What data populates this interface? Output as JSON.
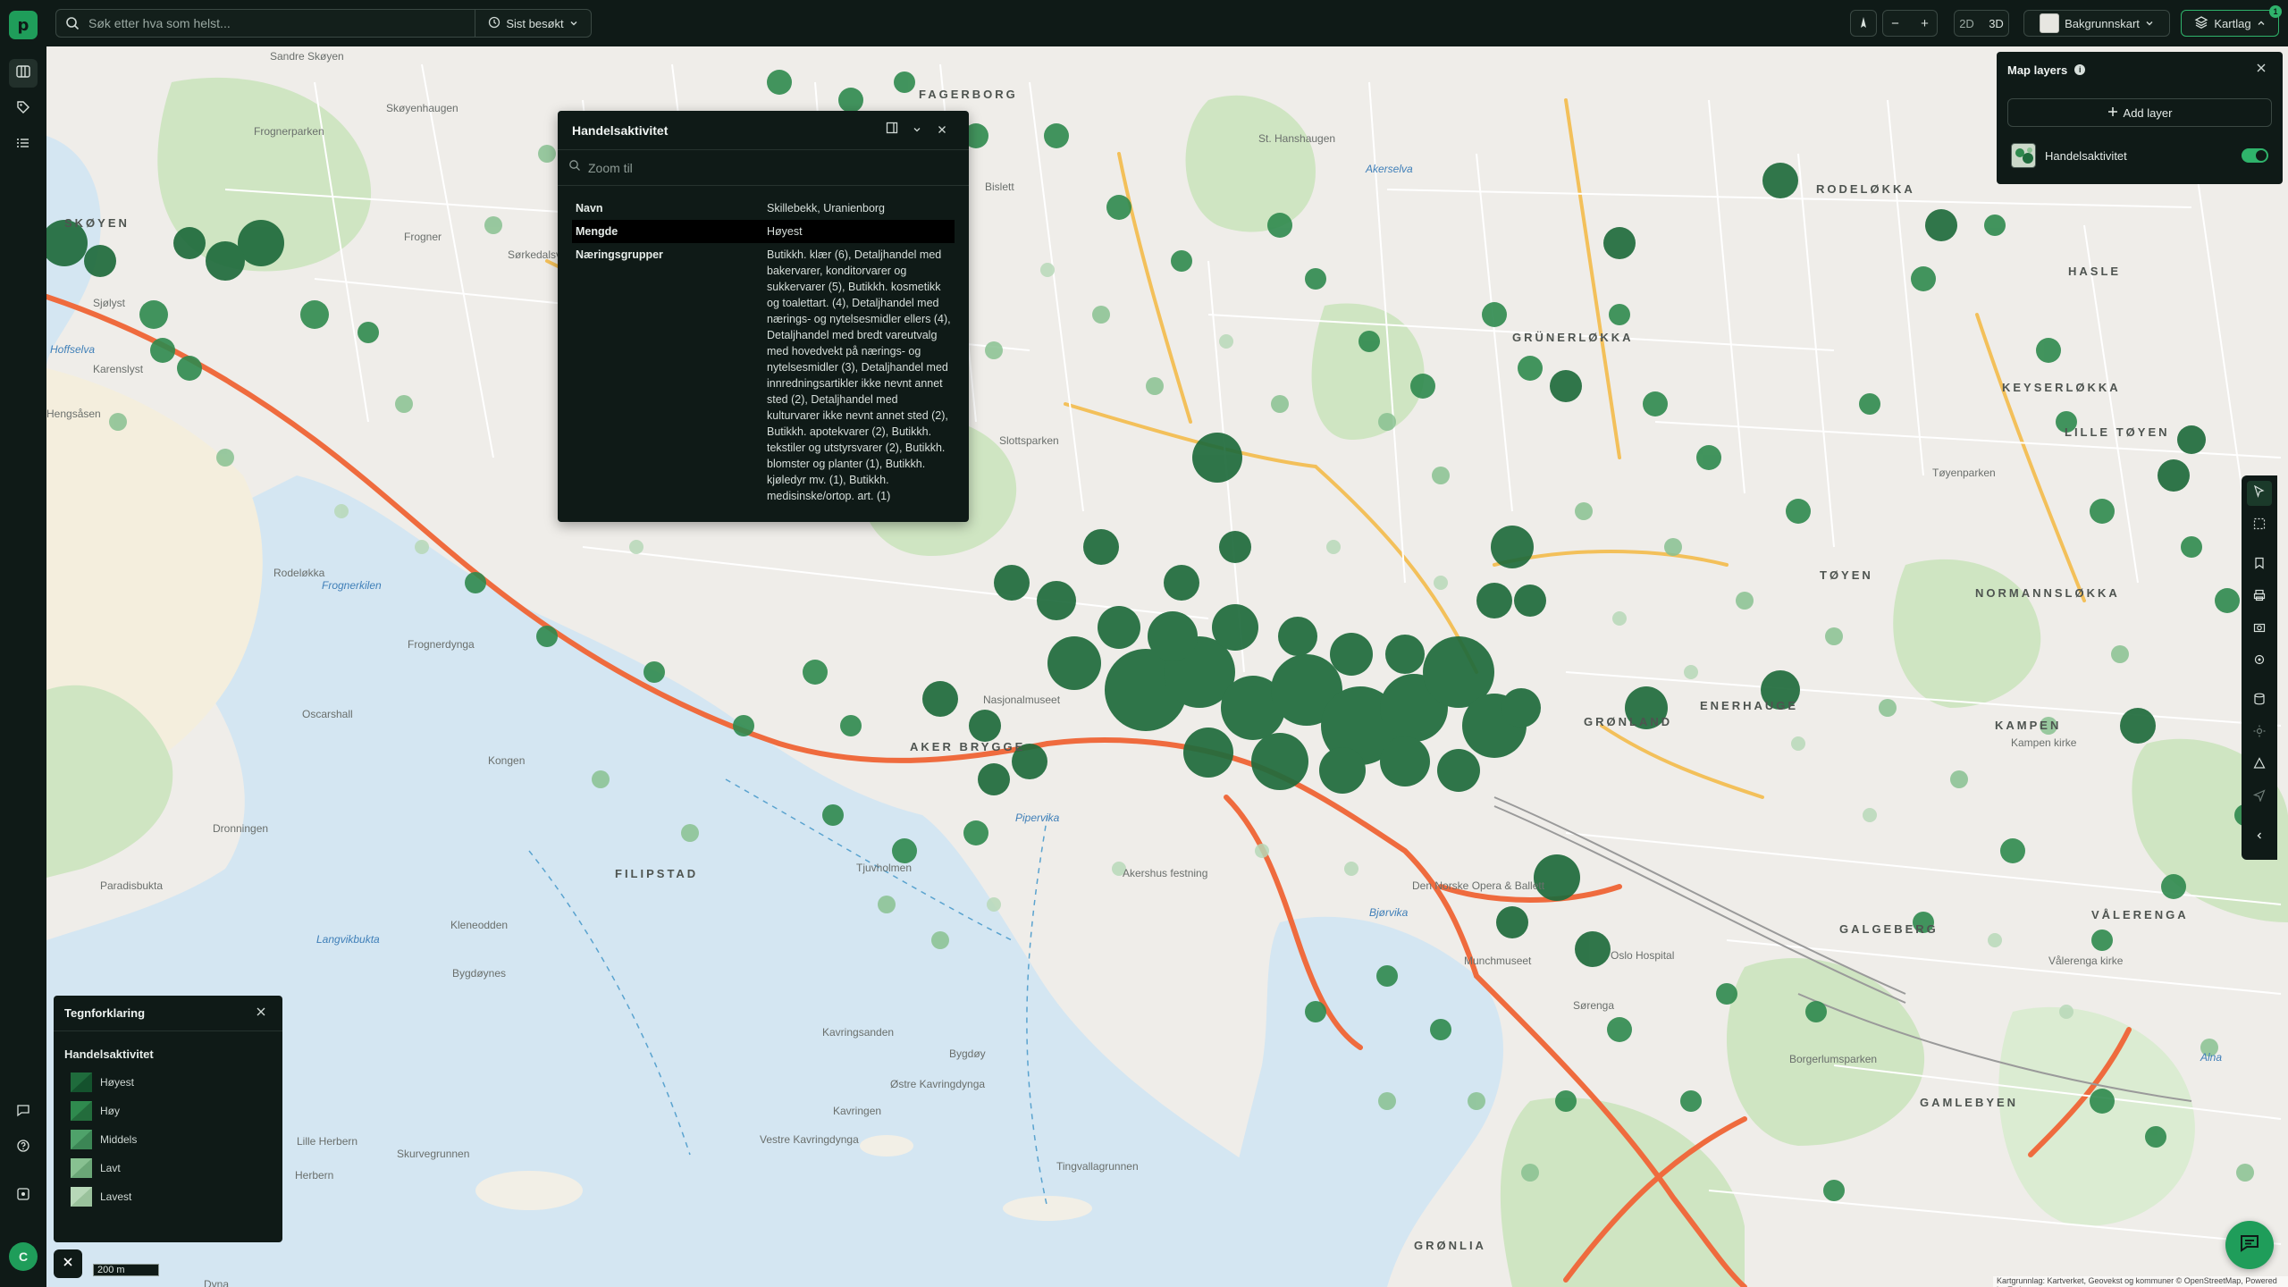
{
  "app": {
    "logo_letter": "p"
  },
  "search": {
    "placeholder": "Søk etter hva som helst...",
    "recent_label": "Sist besøkt"
  },
  "toolbar": {
    "zoom_out": "−",
    "zoom_in": "+",
    "mode_2d": "2D",
    "mode_3d": "3D",
    "basemap_label": "Bakgrunnskart",
    "layers_label": "Kartlag",
    "layers_badge": "1"
  },
  "user": {
    "initial": "C"
  },
  "popup": {
    "title": "Handelsaktivitet",
    "zoom_placeholder": "Zoom til",
    "rows": [
      {
        "key": "Navn",
        "value": "Skillebekk, Uranienborg"
      },
      {
        "key": "Mengde",
        "value": "Høyest"
      },
      {
        "key": "Næringsgrupper",
        "value": "Butikkh. klær (6), Detaljhandel med bakervarer, konditorvarer og sukkervarer (5), Butikkh. kosmetikk og toalettart. (4), Detaljhandel med nærings- og nytelsesmidler ellers (4), Detaljhandel med bredt vareutvalg med hovedvekt på nærings- og nytelsesmidler (3), Detaljhandel med innredningsartikler ikke nevnt annet sted (2), Detaljhandel med kulturvarer ikke nevnt annet sted (2), Butikkh. apotekvarer (2), Butikkh. tekstiler og utstyrsvarer (2), Butikkh. blomster og planter (1), Butikkh. kjøledyr mv. (1), Butikkh. medisinske/ortop. art. (1)"
      }
    ]
  },
  "layers_panel": {
    "title": "Map layers",
    "add_label": "Add layer",
    "items": [
      {
        "name": "Handelsaktivitet",
        "enabled": true
      }
    ]
  },
  "legend": {
    "title": "Tegnforklaring",
    "layer": "Handelsaktivitet",
    "items": [
      {
        "label": "Høyest",
        "color": "#1f6b3c"
      },
      {
        "label": "Høy",
        "color": "#2f8a4e"
      },
      {
        "label": "Middels",
        "color": "#4fa26a"
      },
      {
        "label": "Lavt",
        "color": "#88c191"
      },
      {
        "label": "Lavest",
        "color": "#b7d8b8"
      }
    ]
  },
  "scale": {
    "label": "200 m"
  },
  "attribution": "Kartgrunnlag: Kartverket, Geovekst og kommuner © OpenStreetMap, Powered by Esri",
  "map_labels": {
    "districts": [
      "SKØYEN",
      "FAGERBORG",
      "RODELØKKA",
      "HASLE",
      "GRÜNERLØKKA",
      "KEYSERLØKKA",
      "LILLE TØYEN",
      "TØYEN",
      "NORMANNSLØKKA",
      "ENERHAUGE",
      "KAMPEN",
      "GRØNLAND",
      "AKER BRYGGE",
      "FILIPSTAD",
      "VÅLERENGA",
      "GALGEBERG",
      "GAMLEBYEN",
      "GRØNLIA"
    ],
    "places": [
      "Sandre Skøyen",
      "Skøyenhaugen",
      "Frogner",
      "Frognerparken",
      "Hengsåsen",
      "Karenslyst",
      "Rodeløkka",
      "Bygdøy",
      "Sørkedalsveien",
      "St. Hanshaugen",
      "Akerselva",
      "Bislett",
      "Nasjonalmuseet",
      "Slottsparken",
      "Tjuvholmen",
      "Pipervika",
      "Kavringen",
      "Lille Herbern",
      "Herbern",
      "Skurvegrunnen",
      "Tingvallagrunnen",
      "Vestre Kavringdynga",
      "Østre Kavringdynga",
      "Kavringsanden",
      "Akershus festning",
      "Den Norske Opera & Ballett",
      "Bjørvika",
      "Oslo Hospital",
      "Munch­museet",
      "Sørenga",
      "Vålerenga kirke",
      "Kampen kirke",
      "Tøyenparken",
      "Alna",
      "Bygdøynes",
      "Langvikbukta",
      "Dronningen",
      "Kongen",
      "Oscarshall",
      "Frognerdynga",
      "Paradisbukta",
      "Sjølyst",
      "Hoffselva",
      "Frognerkilen",
      "Borgerlumsparken",
      "Kleneodden",
      "Dyna"
    ]
  }
}
